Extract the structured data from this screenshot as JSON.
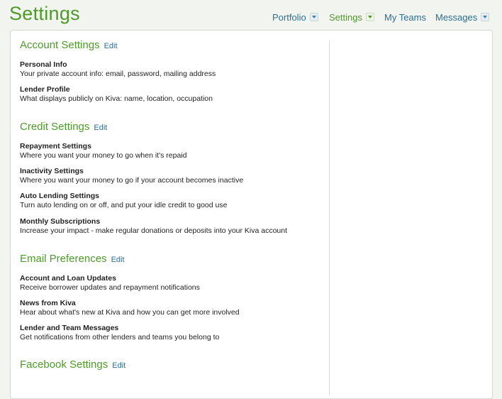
{
  "page": {
    "title": "Settings"
  },
  "nav": {
    "portfolio": "Portfolio",
    "settings": "Settings",
    "my_teams": "My Teams",
    "messages": "Messages"
  },
  "sections": {
    "account": {
      "title": "Account Settings",
      "edit": "Edit",
      "items": [
        {
          "title": "Personal Info",
          "desc": "Your private account info: email, password, mailing address"
        },
        {
          "title": "Lender Profile",
          "desc": "What displays publicly on Kiva: name, location, occupation"
        }
      ]
    },
    "credit": {
      "title": "Credit Settings",
      "edit": "Edit",
      "items": [
        {
          "title": "Repayment Settings",
          "desc": "Where you want your money to go when it's repaid"
        },
        {
          "title": "Inactivity Settings",
          "desc": "Where you want your money to go if your account becomes inactive"
        },
        {
          "title": "Auto Lending Settings",
          "desc": "Turn auto lending on or off, and put your idle credit to good use"
        },
        {
          "title": "Monthly Subscriptions",
          "desc": "Increase your impact - make regular donations or deposits into your Kiva account"
        }
      ]
    },
    "email": {
      "title": "Email Preferences",
      "edit": "Edit",
      "items": [
        {
          "title": "Account and Loan Updates",
          "desc": "Receive borrower updates and repayment notifications"
        },
        {
          "title": "News from Kiva",
          "desc": "Hear about what's new at Kiva and how you can get more involved"
        },
        {
          "title": "Lender and Team Messages",
          "desc": "Get notifications from other lenders and teams you belong to"
        }
      ]
    },
    "facebook": {
      "title": "Facebook Settings",
      "edit": "Edit"
    }
  },
  "colors": {
    "heading_green": "#4e9a2a",
    "link_blue": "#2a6f96"
  },
  "icons": {
    "nav_dropdown": "chevron-down-icon"
  }
}
